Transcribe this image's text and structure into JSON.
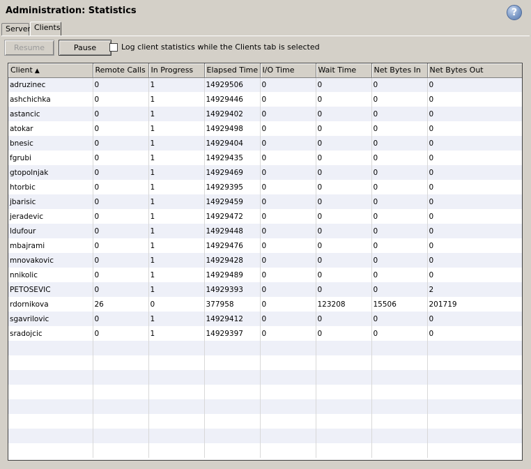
{
  "header": {
    "title": "Administration: Statistics",
    "help_icon": "help-icon",
    "help_glyph": "?"
  },
  "tabs": [
    {
      "label": "Server",
      "selected": false
    },
    {
      "label": "Clients",
      "selected": true
    }
  ],
  "toolbar": {
    "resume_label": "Resume",
    "resume_enabled": false,
    "pause_label": "Pause",
    "log_checkbox_label": "Log client statistics while the Clients tab is selected",
    "log_checkbox_checked": false
  },
  "table": {
    "columns": [
      "Client",
      "Remote Calls",
      "In Progress",
      "Elapsed Time",
      "I/O Time",
      "Wait Time",
      "Net Bytes In",
      "Net Bytes Out"
    ],
    "sort_indicator": "▲",
    "rows": [
      [
        "adruzinec",
        "0",
        "1",
        "14929506",
        "0",
        "0",
        "0",
        "0"
      ],
      [
        "ashchichka",
        "0",
        "1",
        "14929446",
        "0",
        "0",
        "0",
        "0"
      ],
      [
        "astancic",
        "0",
        "1",
        "14929402",
        "0",
        "0",
        "0",
        "0"
      ],
      [
        "atokar",
        "0",
        "1",
        "14929498",
        "0",
        "0",
        "0",
        "0"
      ],
      [
        "bnesic",
        "0",
        "1",
        "14929404",
        "0",
        "0",
        "0",
        "0"
      ],
      [
        "fgrubi",
        "0",
        "1",
        "14929435",
        "0",
        "0",
        "0",
        "0"
      ],
      [
        "gtopolnjak",
        "0",
        "1",
        "14929469",
        "0",
        "0",
        "0",
        "0"
      ],
      [
        "htorbic",
        "0",
        "1",
        "14929395",
        "0",
        "0",
        "0",
        "0"
      ],
      [
        "jbarisic",
        "0",
        "1",
        "14929459",
        "0",
        "0",
        "0",
        "0"
      ],
      [
        "jeradevic",
        "0",
        "1",
        "14929472",
        "0",
        "0",
        "0",
        "0"
      ],
      [
        "ldufour",
        "0",
        "1",
        "14929448",
        "0",
        "0",
        "0",
        "0"
      ],
      [
        "mbajrami",
        "0",
        "1",
        "14929476",
        "0",
        "0",
        "0",
        "0"
      ],
      [
        "mnovakovic",
        "0",
        "1",
        "14929428",
        "0",
        "0",
        "0",
        "0"
      ],
      [
        "nnikolic",
        "0",
        "1",
        "14929489",
        "0",
        "0",
        "0",
        "0"
      ],
      [
        "PETOSEVIC",
        "0",
        "1",
        "14929393",
        "0",
        "0",
        "0",
        "2"
      ],
      [
        "rdornikova",
        "26",
        "0",
        "377958",
        "0",
        "123208",
        "15506",
        "201719"
      ],
      [
        "sgavrilovic",
        "0",
        "1",
        "14929412",
        "0",
        "0",
        "0",
        "0"
      ],
      [
        "sradojcic",
        "0",
        "1",
        "14929397",
        "0",
        "0",
        "0",
        "0"
      ]
    ],
    "empty_rows": 8
  },
  "colors": {
    "background": "#d4d0c8",
    "row_alt": "#eef0f8",
    "help_accent": "#7f9cc8"
  }
}
